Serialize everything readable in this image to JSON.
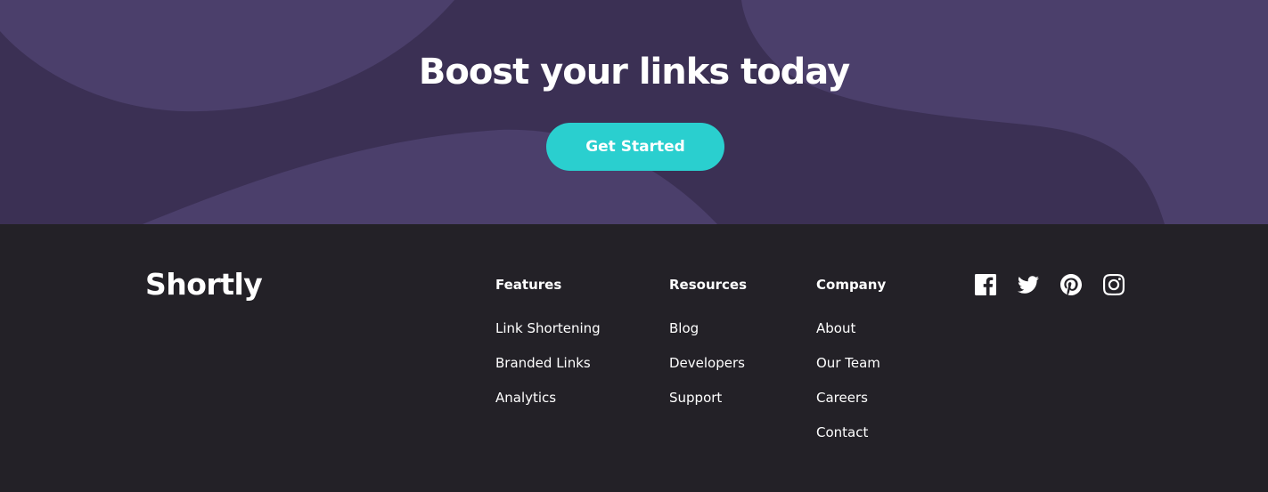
{
  "boost": {
    "title": "Boost your links today",
    "cta_label": "Get Started"
  },
  "footer": {
    "brand": "Shortly",
    "columns": [
      {
        "heading": "Features",
        "links": [
          "Link Shortening",
          "Branded Links",
          "Analytics"
        ]
      },
      {
        "heading": "Resources",
        "links": [
          "Blog",
          "Developers",
          "Support"
        ]
      },
      {
        "heading": "Company",
        "links": [
          "About",
          "Our Team",
          "Careers",
          "Contact"
        ]
      }
    ],
    "social": [
      "facebook-icon",
      "twitter-icon",
      "pinterest-icon",
      "instagram-icon"
    ]
  },
  "colors": {
    "banner_bg": "#3b3054",
    "banner_shape": "#4b3f6b",
    "cta": "#2acfcf",
    "footer_bg": "#232127",
    "text": "#ffffff"
  }
}
